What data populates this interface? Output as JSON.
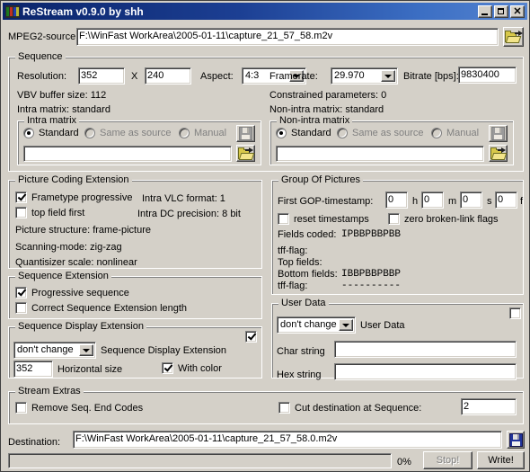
{
  "window": {
    "title": "ReStream v0.9.0 by shh",
    "icon": "app-icon",
    "minimize_label": "_",
    "maximize_label": "□",
    "close_label": "✕"
  },
  "source": {
    "label": "MPEG2-source:",
    "value": "F:\\WinFast WorkArea\\2005-01-11\\capture_21_57_58.m2v",
    "browse_icon": "folder-open-icon"
  },
  "sequence": {
    "title": "Sequence",
    "resolution_label": "Resolution:",
    "width": "352",
    "x_label": "X",
    "height": "240",
    "aspect_label": "Aspect:",
    "aspect_value": "4:3",
    "framerate_label": "Framerate:",
    "framerate_value": "29.970",
    "bitrate_label": "Bitrate [bps]:",
    "bitrate_value": "9830400",
    "vbv_text": "VBV buffer size: 112",
    "constrained_text": "Constrained parameters: 0",
    "intra_matrix_text": "Intra matrix: standard",
    "non_intra_matrix_text": "Non-intra matrix: standard",
    "intra_matrix": {
      "title": "Intra matrix",
      "opt_standard": "Standard",
      "opt_same_as_source": "Same as source",
      "opt_manual": "Manual",
      "selected": "Standard",
      "path_value": "",
      "save_icon": "floppy-save-icon",
      "open_icon": "folder-open-icon"
    },
    "non_intra_matrix": {
      "title": "Non-intra matrix",
      "opt_standard": "Standard",
      "opt_same_as_source": "Same as source",
      "opt_manual": "Manual",
      "selected": "Standard",
      "path_value": "",
      "save_icon": "floppy-save-icon",
      "open_icon": "folder-open-icon"
    }
  },
  "picture_coding_extension": {
    "title": "Picture Coding Extension",
    "frametype_progressive_label": "Frametype progressive",
    "frametype_progressive_checked": true,
    "top_field_first_label": "top field first",
    "top_field_first_checked": false,
    "intra_vlc_text": "Intra VLC format: 1",
    "intra_dc_text": "Intra DC precision: 8 bit",
    "picture_structure_text": "Picture structure: frame-picture",
    "scanning_mode_text": "Scanning-mode: zig-zag",
    "quantisizer_text": "Quantisizer scale: nonlinear"
  },
  "group_of_pictures": {
    "title": "Group Of Pictures",
    "first_gop_label": "First GOP-timestamp:",
    "hours": "0",
    "hours_unit": "h",
    "minutes": "0",
    "minutes_unit": "m",
    "seconds": "0",
    "seconds_unit": "s",
    "frames": "0",
    "frames_unit": "f",
    "reset_timestamps_label": "reset timestamps",
    "reset_timestamps_checked": false,
    "zero_broken_link_label": "zero broken-link flags",
    "zero_broken_link_checked": false,
    "fields_coded_label": "Fields coded:",
    "fields_coded_value": "IPBBPBBPBB",
    "tff_flag_label_1": "tff-flag:",
    "tff_flag_value_1": "",
    "top_fields_label": "Top fields:",
    "top_fields_value": "",
    "bottom_fields_label": "Bottom fields:",
    "bottom_fields_value": "IBBPBBPBBP",
    "tff_flag_label_2": "tff-flag:",
    "tff_flag_value_2": "----------"
  },
  "sequence_extension": {
    "title": "Sequence Extension",
    "progressive_sequence_label": "Progressive sequence",
    "progressive_sequence_checked": true,
    "correct_length_label": "Correct Sequence Extension length",
    "correct_length_checked": false
  },
  "sequence_display_extension": {
    "title": "Sequence Display Extension",
    "enable_checked": true,
    "mode_value": "don't change",
    "mode_label": "Sequence Display Extension",
    "horizontal_size_value": "352",
    "horizontal_size_label": "Horizontal size",
    "with_color_label": "With color",
    "with_color_checked": true
  },
  "user_data": {
    "title": "User Data",
    "enable_checked": false,
    "mode_value": "don't change",
    "mode_label": "User Data",
    "char_string_label": "Char string",
    "char_string_value": "",
    "hex_string_label": "Hex string",
    "hex_string_value": ""
  },
  "stream_extras": {
    "title": "Stream Extras",
    "remove_seq_end_label": "Remove Seq. End Codes",
    "remove_seq_end_checked": false,
    "cut_destination_label": "Cut destination at Sequence:",
    "cut_destination_checked": false,
    "cut_sequence_value": "2"
  },
  "destination": {
    "label": "Destination:",
    "value": "F:\\WinFast WorkArea\\2005-01-11\\capture_21_57_58.0.m2v",
    "save_icon": "floppy-save-icon"
  },
  "statusbar": {
    "progress_percent": 0,
    "progress_text": "0%",
    "stop_label": "Stop!",
    "stop_enabled": false,
    "write_label": "Write!",
    "write_enabled": true
  },
  "colors": {
    "face": "#d4d0c8",
    "titlebar_start": "#0a246a",
    "titlebar_end": "#5684cf",
    "field_bg": "#ffffff",
    "disabled_text": "#808080"
  }
}
